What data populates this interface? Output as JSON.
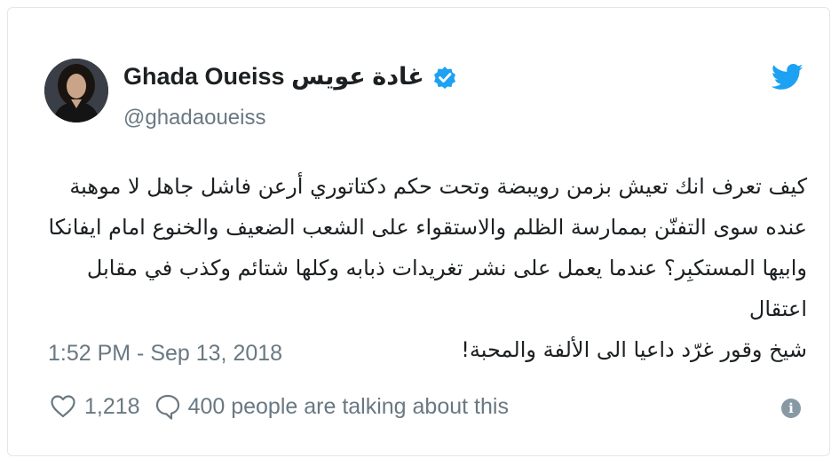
{
  "author": {
    "display_name": "Ghada Oueiss غادة عويس",
    "handle": "@ghadaoueiss",
    "verified": true,
    "avatar_icon": "profile-photo"
  },
  "tweet": {
    "lines": [
      "كيف تعرف انك تعيش بزمن رويبضة وتحت حكم دكتاتوري أرعن فاشل جاهل لا موهبة",
      "عنده سوى التفنّن بممارسة الظلم والاستقواء على الشعب الضعيف والخنوع امام ايفانكا",
      "وابيها المستكبِر؟ عندما يعمل على نشر تغريدات ذبابه وكلها شتائم وكذب في مقابل اعتقال",
      "شيخ وقور غرّد داعيا الى الألفة والمحبة!"
    ],
    "timestamp": "1:52 PM - Sep 13, 2018"
  },
  "actions": {
    "likes": "1,218",
    "talking": "400 people are talking about this",
    "info_glyph": "i"
  },
  "colors": {
    "twitter_blue": "#1da1f2",
    "text": "#1c2022",
    "muted": "#697882"
  },
  "icons": {
    "brand": "twitter-bird-icon",
    "verified": "verified-badge-icon",
    "like": "heart-icon",
    "reply": "speech-bubble-icon",
    "info": "info-icon"
  }
}
